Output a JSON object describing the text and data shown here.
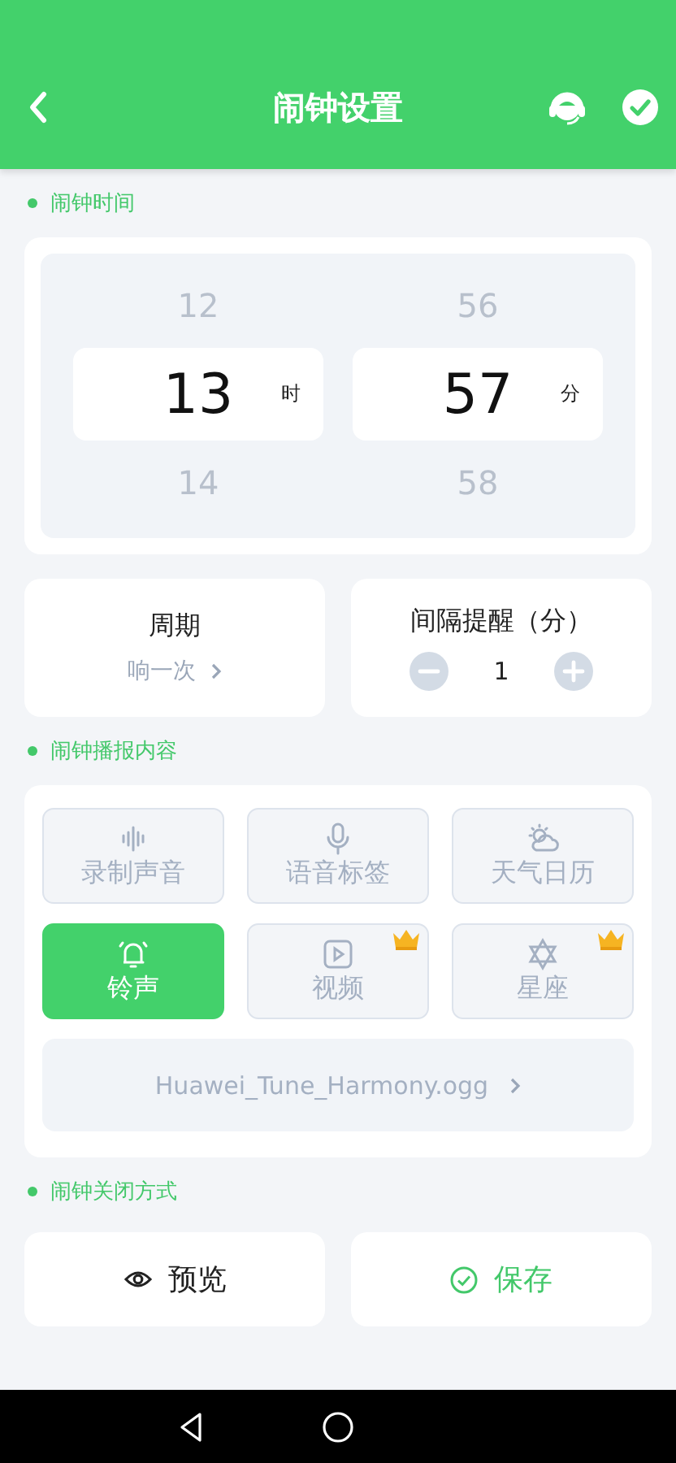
{
  "header": {
    "title": "闹钟设置"
  },
  "time_section": {
    "title": "闹钟时间"
  },
  "time_picker": [
    {
      "prev": "12",
      "value": "13",
      "next": "14",
      "unit": "时"
    },
    {
      "prev": "56",
      "value": "57",
      "next": "58",
      "unit": "分"
    }
  ],
  "period": {
    "label": "周期",
    "value": "响一次"
  },
  "interval": {
    "label": "间隔提醒（分）",
    "value": "1"
  },
  "content_section": {
    "title": "闹钟播报内容"
  },
  "content_options": [
    {
      "kind": "record",
      "label": "录制声音",
      "selected": false,
      "premium": false
    },
    {
      "kind": "voice",
      "label": "语音标签",
      "selected": false,
      "premium": false
    },
    {
      "kind": "weather",
      "label": "天气日历",
      "selected": false,
      "premium": false
    },
    {
      "kind": "ringtone",
      "label": "铃声",
      "selected": true,
      "premium": false
    },
    {
      "kind": "video",
      "label": "视频",
      "selected": false,
      "premium": true
    },
    {
      "kind": "zodiac",
      "label": "星座",
      "selected": false,
      "premium": true
    }
  ],
  "ringtone_file": "Huawei_Tune_Harmony.ogg",
  "close_section": {
    "title": "闹钟关闭方式"
  },
  "buttons": [
    {
      "kind": "preview",
      "label": "预览"
    },
    {
      "kind": "save",
      "label": "保存"
    }
  ]
}
